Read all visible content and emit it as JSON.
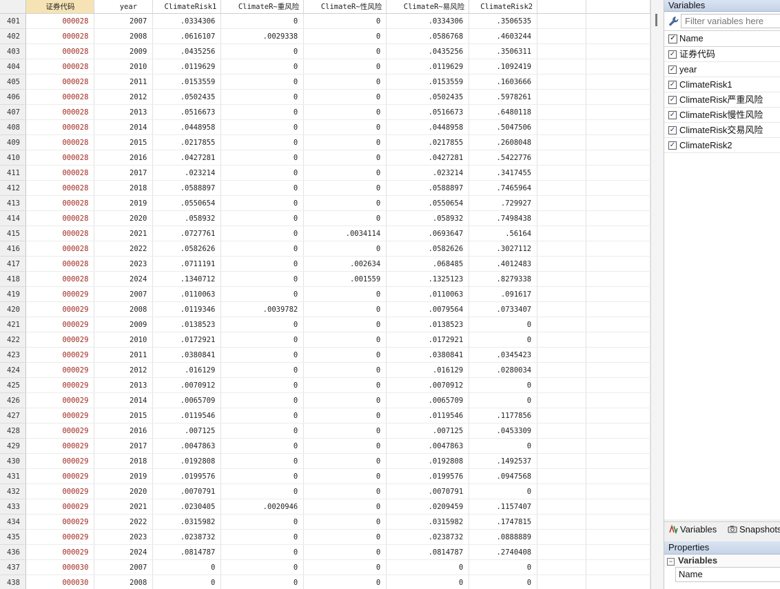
{
  "grid": {
    "headers": [
      "证券代码",
      "year",
      "ClimateRisk1",
      "ClimateR~重风险",
      "ClimateR~性风险",
      "ClimateR~易风险",
      "ClimateRisk2"
    ],
    "rows": [
      [
        "401",
        "000028",
        "2007",
        ".0334306",
        "0",
        "0",
        ".0334306",
        ".3506535"
      ],
      [
        "402",
        "000028",
        "2008",
        ".0616107",
        ".0029338",
        "0",
        ".0586768",
        ".4603244"
      ],
      [
        "403",
        "000028",
        "2009",
        ".0435256",
        "0",
        "0",
        ".0435256",
        ".3506311"
      ],
      [
        "404",
        "000028",
        "2010",
        ".0119629",
        "0",
        "0",
        ".0119629",
        ".1092419"
      ],
      [
        "405",
        "000028",
        "2011",
        ".0153559",
        "0",
        "0",
        ".0153559",
        ".1603666"
      ],
      [
        "406",
        "000028",
        "2012",
        ".0502435",
        "0",
        "0",
        ".0502435",
        ".5978261"
      ],
      [
        "407",
        "000028",
        "2013",
        ".0516673",
        "0",
        "0",
        ".0516673",
        ".6480118"
      ],
      [
        "408",
        "000028",
        "2014",
        ".0448958",
        "0",
        "0",
        ".0448958",
        ".5047506"
      ],
      [
        "409",
        "000028",
        "2015",
        ".0217855",
        "0",
        "0",
        ".0217855",
        ".2608048"
      ],
      [
        "410",
        "000028",
        "2016",
        ".0427281",
        "0",
        "0",
        ".0427281",
        ".5422776"
      ],
      [
        "411",
        "000028",
        "2017",
        ".023214",
        "0",
        "0",
        ".023214",
        ".3417455"
      ],
      [
        "412",
        "000028",
        "2018",
        ".0588897",
        "0",
        "0",
        ".0588897",
        ".7465964"
      ],
      [
        "413",
        "000028",
        "2019",
        ".0550654",
        "0",
        "0",
        ".0550654",
        ".729927"
      ],
      [
        "414",
        "000028",
        "2020",
        ".058932",
        "0",
        "0",
        ".058932",
        ".7498438"
      ],
      [
        "415",
        "000028",
        "2021",
        ".0727761",
        "0",
        ".0034114",
        ".0693647",
        ".56164"
      ],
      [
        "416",
        "000028",
        "2022",
        ".0582626",
        "0",
        "0",
        ".0582626",
        ".3027112"
      ],
      [
        "417",
        "000028",
        "2023",
        ".0711191",
        "0",
        ".002634",
        ".068485",
        ".4012483"
      ],
      [
        "418",
        "000028",
        "2024",
        ".1340712",
        "0",
        ".001559",
        ".1325123",
        ".8279338"
      ],
      [
        "419",
        "000029",
        "2007",
        ".0110063",
        "0",
        "0",
        ".0110063",
        ".091617"
      ],
      [
        "420",
        "000029",
        "2008",
        ".0119346",
        ".0039782",
        "0",
        ".0079564",
        ".0733407"
      ],
      [
        "421",
        "000029",
        "2009",
        ".0138523",
        "0",
        "0",
        ".0138523",
        "0"
      ],
      [
        "422",
        "000029",
        "2010",
        ".0172921",
        "0",
        "0",
        ".0172921",
        "0"
      ],
      [
        "423",
        "000029",
        "2011",
        ".0380841",
        "0",
        "0",
        ".0380841",
        ".0345423"
      ],
      [
        "424",
        "000029",
        "2012",
        ".016129",
        "0",
        "0",
        ".016129",
        ".0280034"
      ],
      [
        "425",
        "000029",
        "2013",
        ".0070912",
        "0",
        "0",
        ".0070912",
        "0"
      ],
      [
        "426",
        "000029",
        "2014",
        ".0065709",
        "0",
        "0",
        ".0065709",
        "0"
      ],
      [
        "427",
        "000029",
        "2015",
        ".0119546",
        "0",
        "0",
        ".0119546",
        ".1177856"
      ],
      [
        "428",
        "000029",
        "2016",
        ".007125",
        "0",
        "0",
        ".007125",
        ".0453309"
      ],
      [
        "429",
        "000029",
        "2017",
        ".0047863",
        "0",
        "0",
        ".0047863",
        "0"
      ],
      [
        "430",
        "000029",
        "2018",
        ".0192808",
        "0",
        "0",
        ".0192808",
        ".1492537"
      ],
      [
        "431",
        "000029",
        "2019",
        ".0199576",
        "0",
        "0",
        ".0199576",
        ".0947568"
      ],
      [
        "432",
        "000029",
        "2020",
        ".0070791",
        "0",
        "0",
        ".0070791",
        "0"
      ],
      [
        "433",
        "000029",
        "2021",
        ".0230405",
        ".0020946",
        "0",
        ".0209459",
        ".1157407"
      ],
      [
        "434",
        "000029",
        "2022",
        ".0315982",
        "0",
        "0",
        ".0315982",
        ".1747815"
      ],
      [
        "435",
        "000029",
        "2023",
        ".0238732",
        "0",
        "0",
        ".0238732",
        ".0888889"
      ],
      [
        "436",
        "000029",
        "2024",
        ".0814787",
        "0",
        "0",
        ".0814787",
        ".2740408"
      ],
      [
        "437",
        "000030",
        "2007",
        "0",
        "0",
        "0",
        "0",
        "0"
      ],
      [
        "438",
        "000030",
        "2008",
        "0",
        "0",
        "0",
        "0",
        "0"
      ]
    ]
  },
  "panel": {
    "variables_title": "Variables",
    "filter_placeholder": "Filter variables here",
    "name_header": "Name",
    "variables": [
      "证券代码",
      "year",
      "ClimateRisk1",
      "ClimateRisk严重风险",
      "ClimateRisk慢性风险",
      "ClimateRisk交易风险",
      "ClimateRisk2"
    ],
    "tabs": {
      "variables": "Variables",
      "snapshots": "Snapshots"
    },
    "properties_title": "Properties",
    "properties_group": "Variables",
    "properties_name_label": "Name"
  },
  "colors": {
    "code_text": "#a0281f",
    "selected_header": "#f6e3b5",
    "panel_title": "#c6d4e8"
  },
  "icons": {
    "filter": "wrench-icon",
    "tab_variables": "variables-tab-icon",
    "tab_snapshots": "camera-icon"
  }
}
